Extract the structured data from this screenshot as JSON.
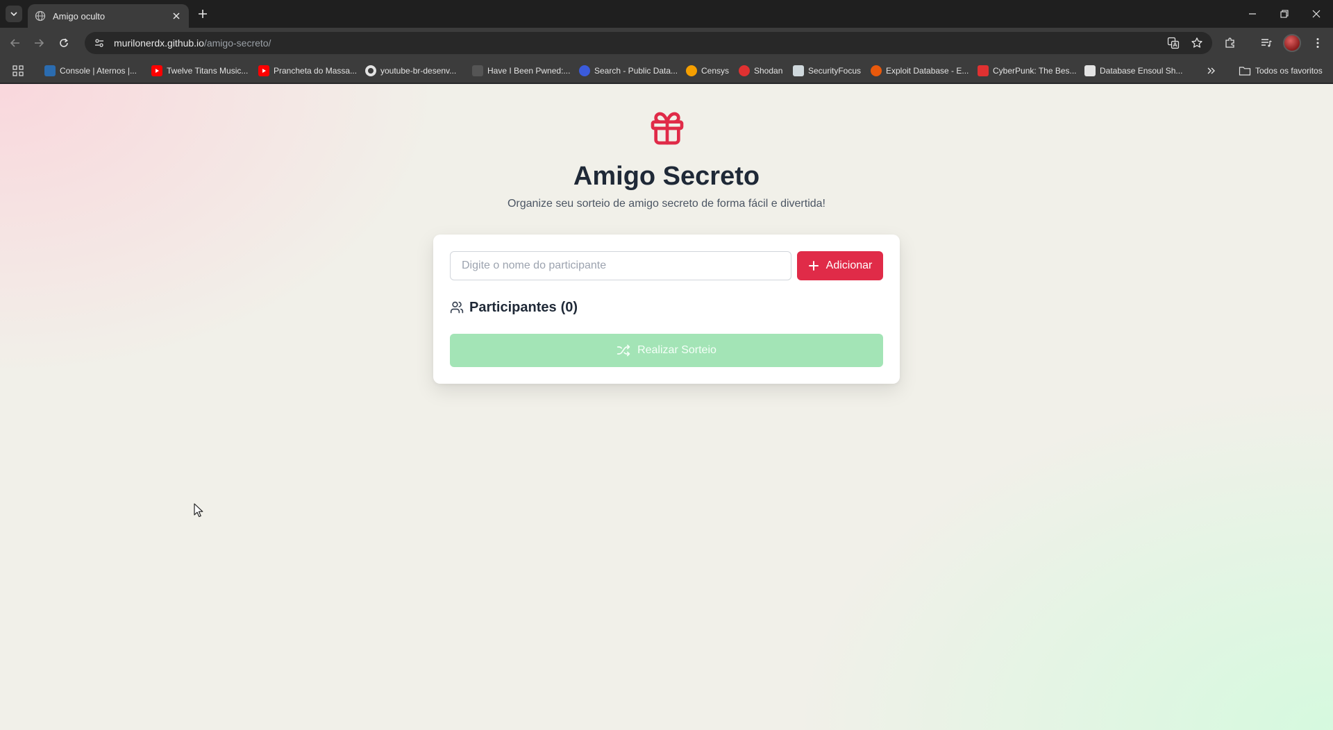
{
  "browser": {
    "tab": {
      "title": "Amigo oculto",
      "favicon": "globe-icon"
    },
    "address": {
      "host": "murilonerdx.github.io",
      "path": "/amigo-secreto/"
    },
    "bookmarks": [
      {
        "label": "Console | Aternos |...",
        "icon": "aternos-icon",
        "color": "#2b6cb0"
      },
      {
        "label": "Twelve Titans Music...",
        "icon": "youtube-icon",
        "color": "#ff0000"
      },
      {
        "label": "Prancheta do Massa...",
        "icon": "youtube-icon",
        "color": "#ff0000"
      },
      {
        "label": "youtube-br-desenv...",
        "icon": "github-icon",
        "color": "#e3e3e3"
      },
      {
        "label": "Have I Been Pwned:...",
        "icon": "hibp-icon",
        "color": "#555555"
      },
      {
        "label": "Search - Public Data...",
        "icon": "globe-icon",
        "color": "#3b5bdb"
      },
      {
        "label": "Censys",
        "icon": "censys-icon",
        "color": "#f59f00"
      },
      {
        "label": "Shodan",
        "icon": "shodan-icon",
        "color": "#e03131"
      },
      {
        "label": "SecurityFocus",
        "icon": "securityfocus-icon",
        "color": "#cfd8dc"
      },
      {
        "label": "Exploit Database - E...",
        "icon": "exploitdb-icon",
        "color": "#e8590c"
      },
      {
        "label": "CyberPunk: The Bes...",
        "icon": "cyberpunk-icon",
        "color": "#e03131"
      },
      {
        "label": "Database Ensoul Sh...",
        "icon": "document-icon",
        "color": "#e3e3e3"
      }
    ],
    "all_bookmarks_label": "Todos os favoritos"
  },
  "app": {
    "title": "Amigo Secreto",
    "subtitle": "Organize seu sorteio de amigo secreto de forma fácil e divertida!",
    "accent_color": "#e02b48",
    "success_color": "#a3e4b6",
    "input": {
      "placeholder": "Digite o nome do participante",
      "value": ""
    },
    "add_button": "Adicionar",
    "participants": {
      "label": "Participantes",
      "count": "(0)"
    },
    "draw_button": "Realizar Sorteio"
  }
}
